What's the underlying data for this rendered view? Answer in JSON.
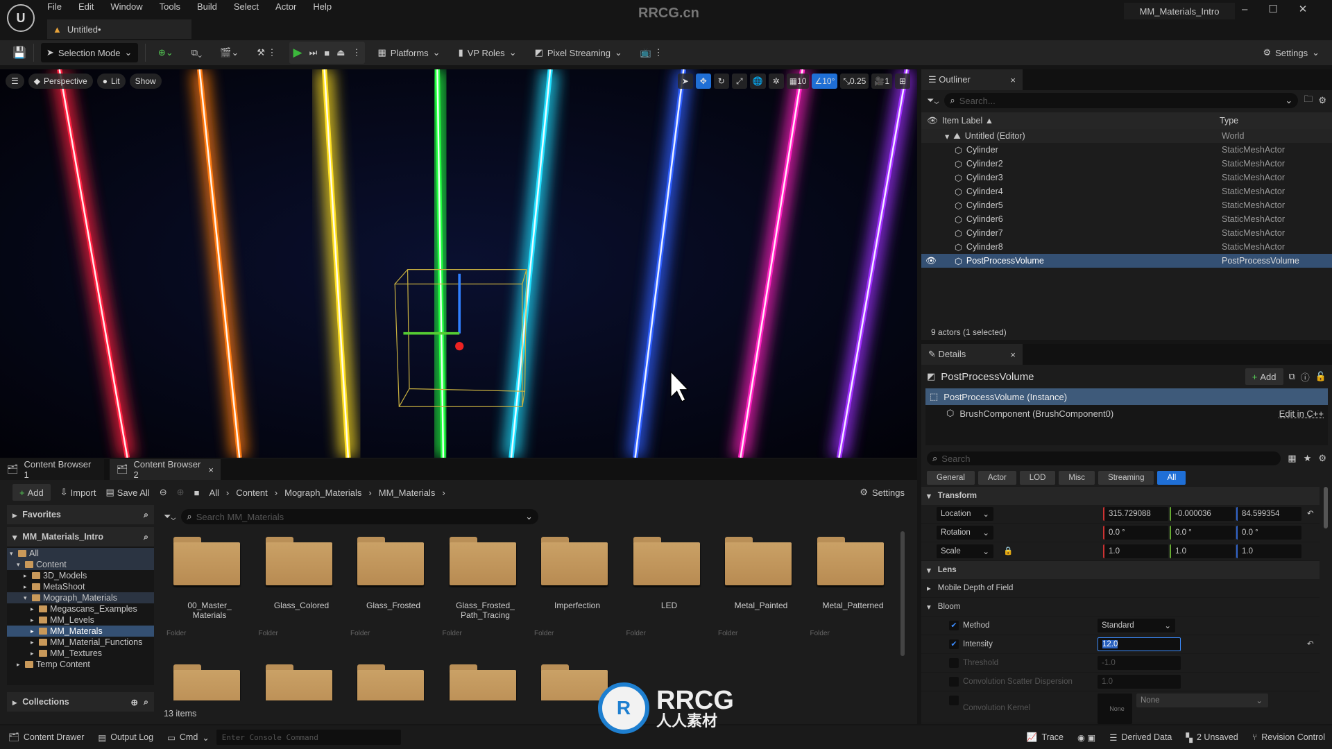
{
  "app": {
    "menu": [
      "File",
      "Edit",
      "Window",
      "Tools",
      "Build",
      "Select",
      "Actor",
      "Help"
    ],
    "doc_tab": "Untitled•",
    "watermark": "RRCG.cn",
    "project": "MM_Materials_Intro",
    "window_controls": [
      "–",
      "☐",
      "✕"
    ]
  },
  "toolbar": {
    "selection_mode": "Selection Mode",
    "platforms": "Platforms",
    "vp_roles": "VP Roles",
    "pixel_streaming": "Pixel Streaming",
    "settings": "Settings"
  },
  "viewport": {
    "perspective": "Perspective",
    "lit": "Lit",
    "show": "Show",
    "grid_snap": "10",
    "rot_snap": "10°",
    "scale_snap": "0.25",
    "camera_speed": "1",
    "light_colors": [
      "#ff2040",
      "#ff7a10",
      "#ffe020",
      "#20ff40",
      "#20e0ff",
      "#3060ff",
      "#ff20c0",
      "#a030ff"
    ]
  },
  "outliner": {
    "title": "Outliner",
    "search_placeholder": "Search...",
    "col_label": "Item Label ▲",
    "col_type": "Type",
    "root": {
      "label": "Untitled (Editor)",
      "type": "World"
    },
    "items": [
      {
        "label": "Cylinder",
        "type": "StaticMeshActor"
      },
      {
        "label": "Cylinder2",
        "type": "StaticMeshActor"
      },
      {
        "label": "Cylinder3",
        "type": "StaticMeshActor"
      },
      {
        "label": "Cylinder4",
        "type": "StaticMeshActor"
      },
      {
        "label": "Cylinder5",
        "type": "StaticMeshActor"
      },
      {
        "label": "Cylinder6",
        "type": "StaticMeshActor"
      },
      {
        "label": "Cylinder7",
        "type": "StaticMeshActor"
      },
      {
        "label": "Cylinder8",
        "type": "StaticMeshActor"
      },
      {
        "label": "PostProcessVolume",
        "type": "PostProcessVolume",
        "selected": true
      }
    ],
    "footer": "9 actors (1 selected)"
  },
  "details": {
    "title": "Details",
    "actor": "PostProcessVolume",
    "add": "Add",
    "instance": "PostProcessVolume (Instance)",
    "component": "BrushComponent (BrushComponent0)",
    "edit_cpp": "Edit in C++",
    "search_placeholder": "Search",
    "filters": [
      "General",
      "Actor",
      "LOD",
      "Misc",
      "Streaming",
      "All"
    ],
    "active_filter": "All",
    "transform": {
      "title": "Transform",
      "location": {
        "label": "Location",
        "x": "315.729088",
        "y": "-0.000036",
        "z": "84.599354"
      },
      "rotation": {
        "label": "Rotation",
        "x": "0.0 °",
        "y": "0.0 °",
        "z": "0.0 °"
      },
      "scale": {
        "label": "Scale",
        "x": "1.0",
        "y": "1.0",
        "z": "1.0"
      }
    },
    "lens": {
      "title": "Lens",
      "mobile_dof": "Mobile Depth of Field",
      "bloom": "Bloom",
      "method": {
        "label": "Method",
        "value": "Standard",
        "checked": true
      },
      "intensity": {
        "label": "Intensity",
        "value": "12.0",
        "checked": true
      },
      "threshold": {
        "label": "Threshold",
        "value": "-1.0",
        "checked": false
      },
      "scatter": {
        "label": "Convolution Scatter Dispersion",
        "value": "1.0",
        "checked": false
      },
      "kernel": {
        "label": "Convolution Kernel",
        "thumb": "None",
        "value": "None",
        "checked": false
      }
    }
  },
  "content_browser": {
    "tabs": [
      "Content Browser 1",
      "Content Browser 2"
    ],
    "add": "Add",
    "import": "Import",
    "save_all": "Save All",
    "breadcrumb": [
      "All",
      "Content",
      "Mograph_Materials",
      "MM_Materials"
    ],
    "settings": "Settings",
    "favorites": "Favorites",
    "project": "MM_Materials_Intro",
    "collections": "Collections",
    "search_placeholder": "Search MM_Materials",
    "tree": [
      {
        "label": "All",
        "depth": 0,
        "open": true
      },
      {
        "label": "Content",
        "depth": 1,
        "open": true
      },
      {
        "label": "3D_Models",
        "depth": 2
      },
      {
        "label": "MetaShoot",
        "depth": 2
      },
      {
        "label": "Mograph_Materials",
        "depth": 2,
        "open": true
      },
      {
        "label": "Megascans_Examples",
        "depth": 3
      },
      {
        "label": "MM_Levels",
        "depth": 3
      },
      {
        "label": "MM_Materals",
        "depth": 3,
        "selected": true
      },
      {
        "label": "MM_Material_Functions",
        "depth": 3
      },
      {
        "label": "MM_Textures",
        "depth": 3
      },
      {
        "label": "Temp Content",
        "depth": 1
      }
    ],
    "folders": [
      {
        "name": "00_Master_\nMaterials",
        "type": "Folder"
      },
      {
        "name": "Glass_Colored",
        "type": "Folder"
      },
      {
        "name": "Glass_Frosted",
        "type": "Folder"
      },
      {
        "name": "Glass_Frosted_\nPath_Tracing",
        "type": "Folder"
      },
      {
        "name": "Imperfection",
        "type": "Folder"
      },
      {
        "name": "LED",
        "type": "Folder"
      },
      {
        "name": "Metal_Painted",
        "type": "Folder"
      },
      {
        "name": "Metal_Patterned",
        "type": "Folder"
      }
    ],
    "item_count": "13 items"
  },
  "status": {
    "content_drawer": "Content Drawer",
    "output_log": "Output Log",
    "cmd": "Cmd",
    "console_placeholder": "Enter Console Command",
    "trace": "Trace",
    "derived_data": "Derived Data",
    "unsaved": "2 Unsaved",
    "revision_control": "Revision Control"
  },
  "watermark_logo": {
    "text": "RRCG",
    "sub": "人人素材"
  }
}
